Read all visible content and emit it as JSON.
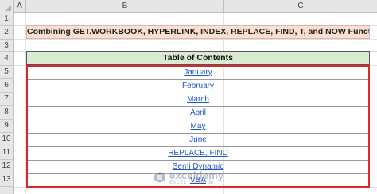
{
  "columns": [
    {
      "label": "A"
    },
    {
      "label": "B"
    },
    {
      "label": "C"
    }
  ],
  "rows": [
    "1",
    "2",
    "3",
    "4",
    "5",
    "6",
    "7",
    "8",
    "9",
    "10",
    "11",
    "12",
    "13"
  ],
  "title": "Combining GET.WORKBOOK, HYPERLINK, INDEX, REPLACE, FIND, T, and NOW Functions",
  "toc_header": "Table of Contents",
  "toc_items": [
    "January",
    "February",
    "March",
    "April",
    "May",
    "June",
    "REPLACE, FIND",
    "Semi Dynamic",
    "VBA"
  ],
  "watermark": {
    "brand": "exceldemy",
    "sub": "EXCEL · DATA · BI"
  },
  "colors": {
    "title_bg": "#fbe0d0",
    "header_bg": "#d9ecd2",
    "border_red": "#e0252b",
    "link": "#1f56c7"
  }
}
